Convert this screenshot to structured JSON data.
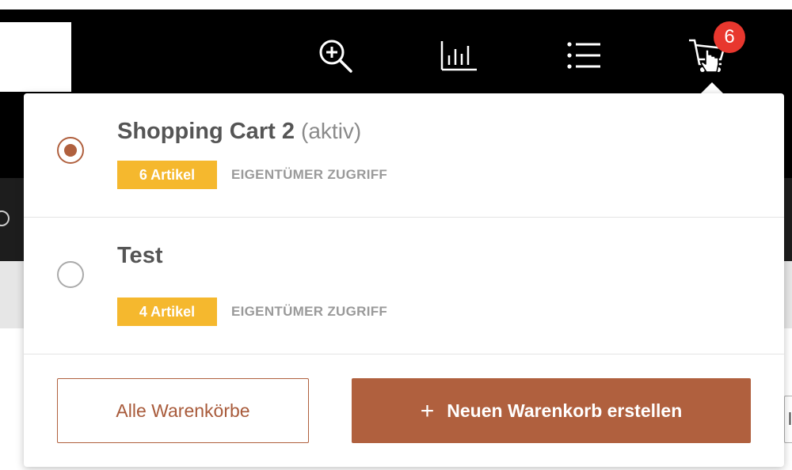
{
  "header": {
    "cart_count": "6",
    "icons": [
      "zoom-in-icon",
      "bar-chart-icon",
      "list-icon",
      "shopping-cart-icon"
    ]
  },
  "dropdown": {
    "carts": [
      {
        "name": "Shopping Cart 2",
        "status": "(aktiv)",
        "items_label": "6 Artikel",
        "access": "EIGENTÜMER ZUGRIFF",
        "selected": true
      },
      {
        "name": "Test",
        "status": "",
        "items_label": "4 Artikel",
        "access": "EIGENTÜMER ZUGRIFF",
        "selected": false
      }
    ],
    "all_carts_label": "Alle Warenkörbe",
    "new_cart_label": "Neuen Warenkorb erstellen",
    "new_cart_icon": "plus-icon"
  },
  "background": {
    "right_peek_text": "l"
  },
  "colors": {
    "accent": "#b0603e",
    "badge_yellow": "#f5b82e",
    "notification_red": "#e8372e",
    "header_bg": "#000000"
  }
}
